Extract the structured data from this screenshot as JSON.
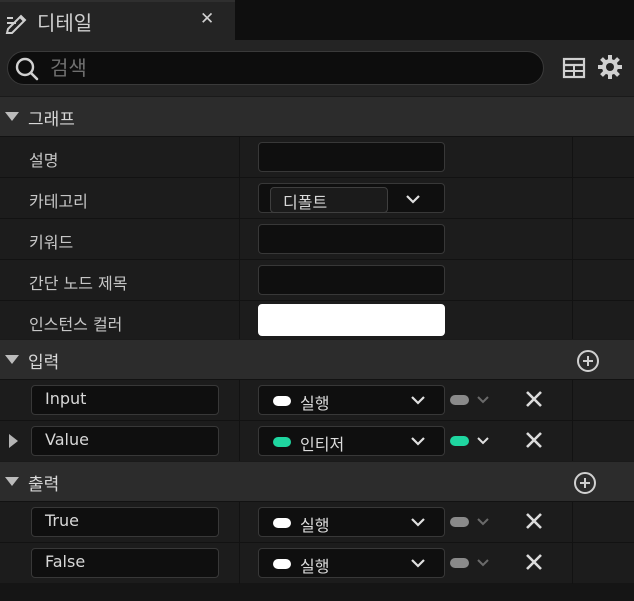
{
  "tab": {
    "title": "디테일",
    "close_glyph": "✕",
    "icon": "pencil-icon"
  },
  "search": {
    "placeholder": "검색",
    "value": ""
  },
  "toolbar_icons": [
    "table-icon",
    "gear-icon"
  ],
  "sections": {
    "graph": {
      "title": "그래프",
      "rows": [
        {
          "label": "설명",
          "value": ""
        },
        {
          "label": "카테고리",
          "value": "디폴트"
        },
        {
          "label": "키워드",
          "value": ""
        },
        {
          "label": "간단 노드 제목",
          "value": ""
        },
        {
          "label": "인스턴스 컬러",
          "value": ""
        }
      ]
    },
    "inputs": {
      "title": "입력",
      "pins": [
        {
          "name": "Input",
          "type": "실행",
          "type_color": "#ffffff"
        },
        {
          "name": "Value",
          "type": "인티저",
          "type_color": "#1fd6a0"
        }
      ]
    },
    "outputs": {
      "title": "출력",
      "pins": [
        {
          "name": "True",
          "type": "실행",
          "type_color": "#ffffff"
        },
        {
          "name": "False",
          "type": "실행",
          "type_color": "#ffffff"
        }
      ]
    }
  },
  "colors": {
    "background": "#151515",
    "panel": "#1c1c1c",
    "header": "#2c2c2c",
    "exec_pin": "#ffffff",
    "integer_pin": "#1fd6a0",
    "container_pin_disabled": "#8a8a8a"
  }
}
